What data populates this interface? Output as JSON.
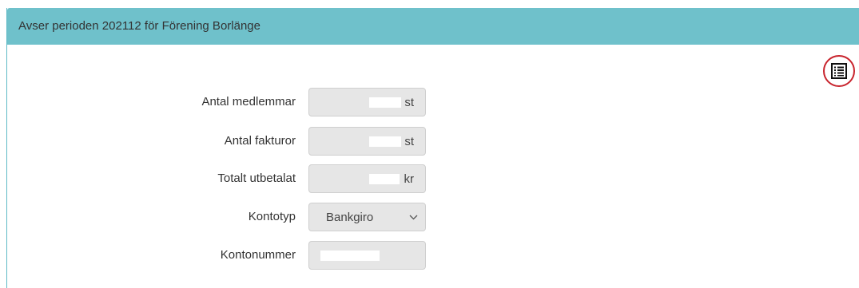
{
  "header": {
    "title": "Avser perioden 202112 för Förening Borlänge"
  },
  "toolbar": {
    "list_icon": "list-icon"
  },
  "form": {
    "members": {
      "label": "Antal medlemmar",
      "unit": "st",
      "value": ""
    },
    "invoices": {
      "label": "Antal fakturor",
      "unit": "st",
      "value": ""
    },
    "paid_total": {
      "label": "Totalt utbetalat",
      "unit": "kr",
      "value": ""
    },
    "account_type": {
      "label": "Kontotyp",
      "selected": "Bankgiro"
    },
    "account_number": {
      "label": "Kontonummer",
      "value": ""
    }
  },
  "colors": {
    "header_bg": "#6fc1cb",
    "field_bg": "#e6e6e6",
    "accent_ring": "#c8232c"
  }
}
